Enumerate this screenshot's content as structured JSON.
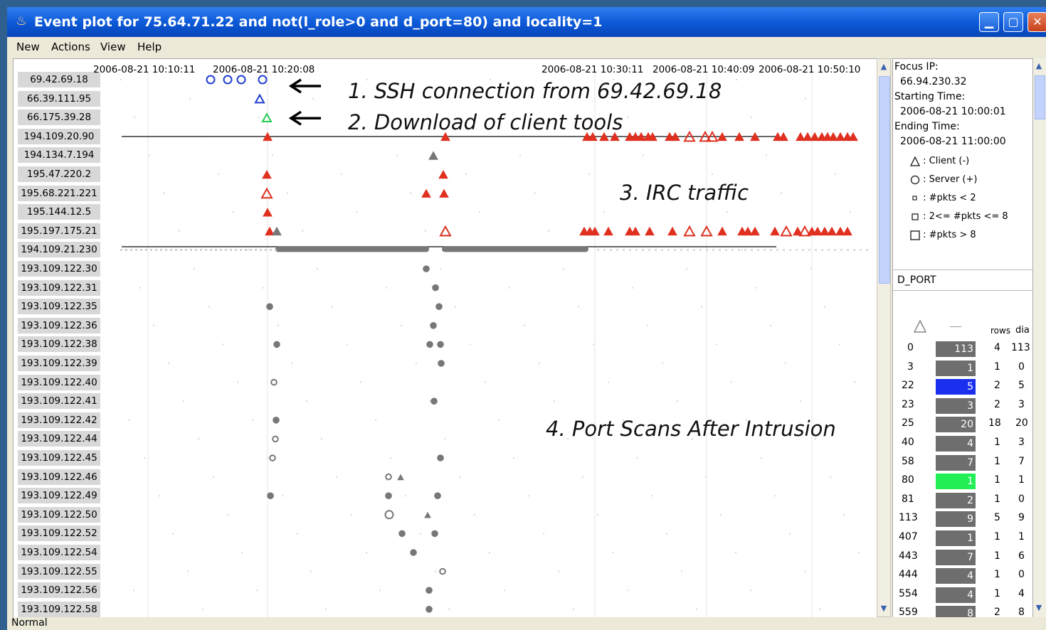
{
  "window": {
    "title": "Event plot for 75.64.71.22 and not(l_role>0 and d_port=80) and locality=1",
    "buttons": [
      "minimize",
      "maximize",
      "close"
    ]
  },
  "menu": [
    "New",
    "Actions",
    "View",
    "Help"
  ],
  "timeline": {
    "timestamps": [
      "2006-08-21 10:10:11",
      "2006-08-21 10:20:08",
      "2006-08-21 10:30:11",
      "2006-08-21 10:40:09",
      "2006-08-21 10:50:10"
    ]
  },
  "rows": [
    "69.42.69.18",
    "66.39.111.95",
    "66.175.39.28",
    "194.109.20.90",
    "194.134.7.194",
    "195.47.220.2",
    "195.68.221.221",
    "195.144.12.5",
    "195.197.175.21",
    "194.109.21.230",
    "193.109.122.30",
    "193.109.122.31",
    "193.109.122.35",
    "193.109.122.36",
    "193.109.122.38",
    "193.109.122.39",
    "193.109.122.40",
    "193.109.122.41",
    "193.109.122.42",
    "193.109.122.44",
    "193.109.122.45",
    "193.109.122.46",
    "193.109.122.49",
    "193.109.122.50",
    "193.109.122.52",
    "193.109.122.54",
    "193.109.122.55",
    "193.109.122.56",
    "193.109.122.58"
  ],
  "annotations": {
    "note1": "1. SSH connection from 69.42.69.18",
    "note2": "2. Download of client tools",
    "note3": "3. IRC traffic",
    "note4": "4. Port Scans After Intrusion"
  },
  "colors": {
    "ssh": "#1f3fd0",
    "download": "#22cc55",
    "irc": "#e03020",
    "gray": "#777777",
    "highlight_blue": "#1b2ff0",
    "highlight_green": "#22ee55"
  },
  "info": {
    "focus_label": "Focus IP:",
    "focus_ip": "66.94.230.32",
    "start_label": "Starting Time:",
    "start_time": "2006-08-21 10:00:01",
    "end_label": "Ending Time:",
    "end_time": "2006-08-21 11:00:00"
  },
  "legend": [
    {
      "icon": "triangle-icon",
      "text": ": Client (-)"
    },
    {
      "icon": "circle-icon",
      "text": ": Server (+)"
    },
    {
      "icon": "tiny-square-icon",
      "text": ": #pkts < 2"
    },
    {
      "icon": "small-square-icon",
      "text": ": 2<= #pkts <= 8"
    },
    {
      "icon": "large-square-icon",
      "text": ": #pkts > 8"
    }
  ],
  "field": "D_PORT",
  "port_table": {
    "headers": [
      "rows",
      "dia"
    ],
    "rows": [
      {
        "port": "0",
        "count": "113",
        "rows": "4",
        "dia": "113"
      },
      {
        "port": "3",
        "count": "1",
        "rows": "1",
        "dia": "0"
      },
      {
        "port": "22",
        "count": "5",
        "rows": "2",
        "dia": "5",
        "highlight": "blue"
      },
      {
        "port": "23",
        "count": "3",
        "rows": "2",
        "dia": "3"
      },
      {
        "port": "25",
        "count": "20",
        "rows": "18",
        "dia": "20"
      },
      {
        "port": "40",
        "count": "4",
        "rows": "1",
        "dia": "3"
      },
      {
        "port": "58",
        "count": "7",
        "rows": "1",
        "dia": "7"
      },
      {
        "port": "80",
        "count": "1",
        "rows": "1",
        "dia": "1",
        "highlight": "green"
      },
      {
        "port": "81",
        "count": "2",
        "rows": "1",
        "dia": "0"
      },
      {
        "port": "113",
        "count": "9",
        "rows": "5",
        "dia": "9"
      },
      {
        "port": "407",
        "count": "1",
        "rows": "1",
        "dia": "1"
      },
      {
        "port": "443",
        "count": "7",
        "rows": "1",
        "dia": "6"
      },
      {
        "port": "444",
        "count": "4",
        "rows": "1",
        "dia": "0"
      },
      {
        "port": "554",
        "count": "4",
        "rows": "1",
        "dia": "4"
      },
      {
        "port": "559",
        "count": "8",
        "rows": "2",
        "dia": "8"
      }
    ]
  },
  "status": "Normal"
}
